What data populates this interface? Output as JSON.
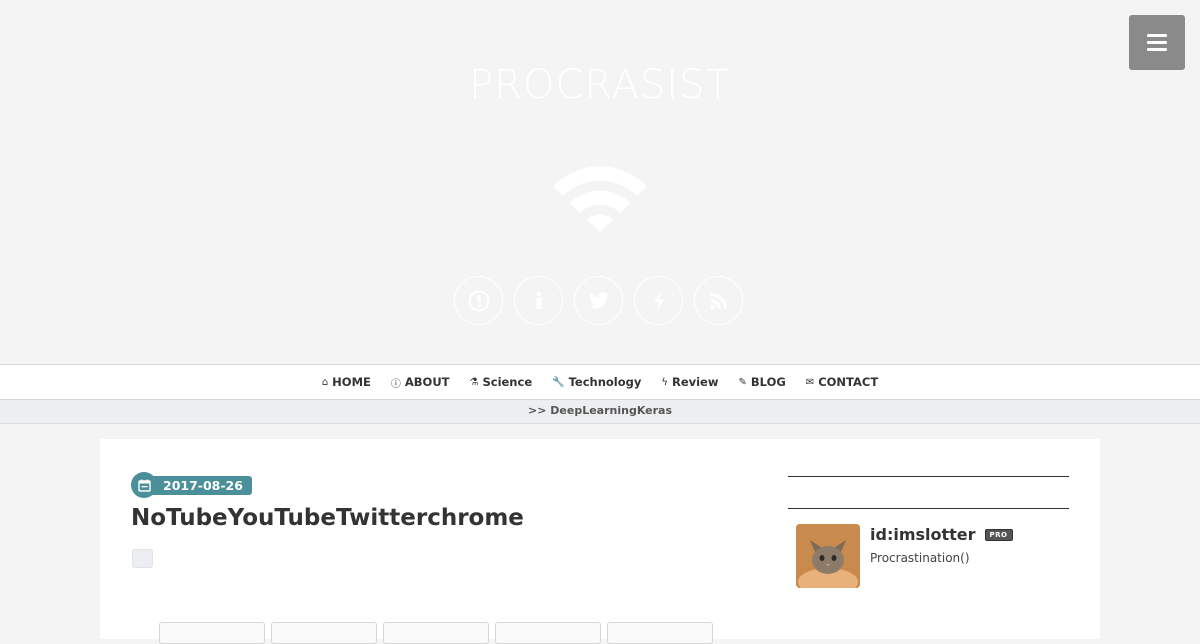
{
  "site": {
    "title": "PROCRASIST",
    "menu_icon": "hamburger-menu-icon"
  },
  "social_icons": [
    {
      "name": "hatena-icon",
      "glyph": "B!"
    },
    {
      "name": "info-icon",
      "glyph": "i"
    },
    {
      "name": "twitter-icon",
      "glyph": "🐦"
    },
    {
      "name": "bolt-icon",
      "glyph": "ϟ"
    },
    {
      "name": "rss-icon",
      "glyph": ")))"
    }
  ],
  "nav": {
    "items": [
      {
        "icon": "⌂",
        "label": "HOME"
      },
      {
        "icon": "ⓘ",
        "label": "ABOUT"
      },
      {
        "icon": "⚗",
        "label": "Science"
      },
      {
        "icon": "🔧",
        "label": "Technology"
      },
      {
        "icon": "ϟ",
        "label": "Review"
      },
      {
        "icon": "✎",
        "label": "BLOG"
      },
      {
        "icon": "✉",
        "label": "CONTACT"
      }
    ]
  },
  "breadcrumb": ">> DeepLearningKeras",
  "entry": {
    "date": "2017-08-26",
    "title": "NoTubeYouTubeTwitterchrome"
  },
  "profile": {
    "id": "id:imslotter",
    "badge": "PRO",
    "description": "Procrastination()"
  },
  "colors": {
    "accent": "#4a8f99",
    "background": "#f4f4f4",
    "menu_button": "#8a8a8a"
  }
}
